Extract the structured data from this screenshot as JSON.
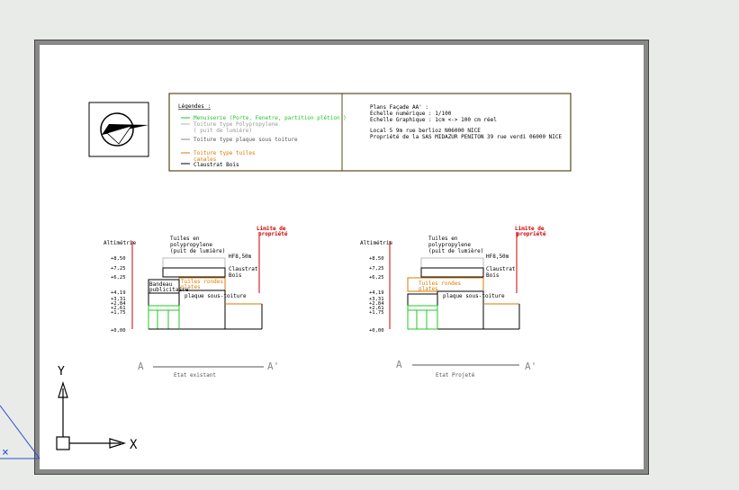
{
  "legend": {
    "title": "Légendes :",
    "items": [
      {
        "label": "Menuiserie (Porte, Fenetre, partition plétion )",
        "color": "#22c822"
      },
      {
        "label": "Toiture type Polypropylene",
        "sub": "( puit de lumière)",
        "color": "#b0b0b0"
      },
      {
        "label": "Toiture type plaque sous toiture",
        "color": "#888888"
      },
      {
        "label": "Toiture  type tuiles",
        "sub": "canales",
        "color": "#d87a00"
      },
      {
        "label": "Claustrat Bois",
        "color": "#000000"
      }
    ]
  },
  "info": {
    "line1": "Plans Façade AA' :",
    "line2": "Echelle numérique : 1/100",
    "line3": "Echelle Graphique : 1cm <-> 100 cm réel",
    "line4": "Local 5 9m rue berlioz N06000 NICE",
    "line5": "Propriété de la SAS MIDAZUR PENITON 39 rue verdi 06000 NICE"
  },
  "left_elevation": {
    "altimetrie": "Altimétrie",
    "levels": [
      "+8,50",
      "+7,25",
      "+6,25",
      "+4,19",
      "+3,31",
      "+2,84",
      "+2,61",
      "+1,75",
      "+0,00"
    ],
    "tuiles_poly": "Tuiles en",
    "tuiles_poly2": "polypropylene",
    "tuiles_poly3": "(puit de lumière)",
    "hf": "HF8,50m",
    "claustrat": "Claustrat",
    "bois": "Bois",
    "bandeau": "Bandeau",
    "publicitaire": "publicitaire",
    "tuiles_rondes": "Tuiles rondes",
    "tuiles_rondes2": "plates",
    "plaque": "plaque sous-toiture",
    "limite": "Limite de",
    "propriete": "propriété",
    "a": "A",
    "a_prime": "A'",
    "caption": "Etat existant"
  },
  "right_elevation": {
    "altimetrie": "Altimétrie",
    "levels": [
      "+8,50",
      "+7,25",
      "+6,25",
      "+4,19",
      "+3,31",
      "+2,84",
      "+2,61",
      "+1,75",
      "+0,00"
    ],
    "tuiles_poly": "Tuiles en",
    "tuiles_poly2": "polypropylene",
    "tuiles_poly3": "(puit de lumière)",
    "hf": "HF8,50m",
    "claustrat": "Claustrat",
    "bois": "Bois",
    "tuiles_rondes": "Tuiles rondes",
    "tuiles_rondes2": "plates",
    "plaque": "plaque sous-toiture",
    "limite": "Limite de",
    "propriete": "propriété",
    "a": "A",
    "a_prime": "A'",
    "caption": "Etat Projeté"
  },
  "ucs": {
    "y": "Y",
    "x": "X"
  }
}
